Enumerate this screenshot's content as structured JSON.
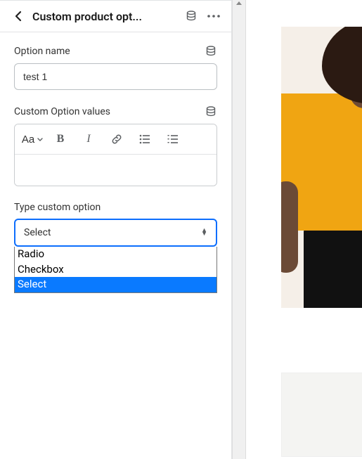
{
  "header": {
    "title": "Custom product opt..."
  },
  "fields": {
    "option_name": {
      "label": "Option name",
      "value": "test 1"
    },
    "custom_option_values": {
      "label": "Custom Option values"
    },
    "type_custom_option": {
      "label": "Type custom option",
      "selected": "Select",
      "options": [
        "Radio",
        "Checkbox",
        "Select"
      ]
    }
  },
  "rte_toolbar": {
    "text_style_label": "Aa"
  }
}
